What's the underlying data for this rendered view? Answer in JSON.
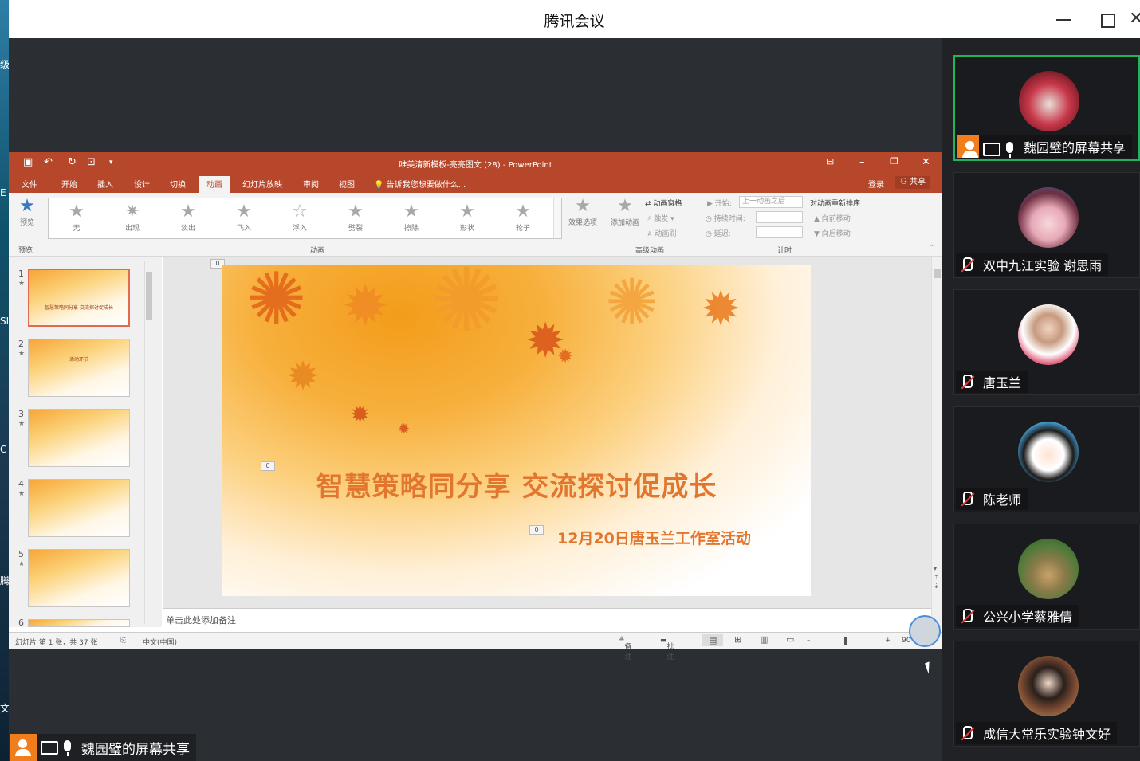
{
  "app": {
    "title": "腾讯会议"
  },
  "ppt": {
    "window_title": "唯美清新模板-亮亮图文 (28) - PowerPoint",
    "tabs": [
      "文件",
      "开始",
      "插入",
      "设计",
      "切换",
      "动画",
      "幻灯片放映",
      "审阅",
      "视图"
    ],
    "active_tab": "动画",
    "tell_me": "告诉我您想要做什么...",
    "login": "登录",
    "share": "共享",
    "preview_label": "预览",
    "preview_group": "预览",
    "animations": [
      "无",
      "出现",
      "淡出",
      "飞入",
      "浮入",
      "劈裂",
      "擦除",
      "形状",
      "轮子"
    ],
    "effect_options": "效果选项",
    "anim_group": "动画",
    "add_animation": "添加动画",
    "anim_pane": "动画窗格",
    "trigger": "触发",
    "anim_painter": "动画刷",
    "advanced_group": "高级动画",
    "start_label": "开始:",
    "start_value": "上一动画之后",
    "duration_label": "持续时间:",
    "delay_label": "延迟:",
    "reorder_title": "对动画重新排序",
    "move_earlier": "向前移动",
    "move_later": "向后移动",
    "timing_group": "计时",
    "slide_numbers": [
      "1",
      "2",
      "3",
      "4",
      "5",
      "6"
    ],
    "thumb_captions": [
      "智慧策略同分享 交流探讨促成长",
      "活动环节",
      "",
      "",
      "",
      ""
    ],
    "slide": {
      "title": "智慧策略同分享  交流探讨促成长",
      "subtitle": "12月20日唐玉兰工作室活动",
      "markers": [
        "0",
        "0",
        "0"
      ]
    },
    "notes_placeholder": "单击此处添加备注",
    "status": {
      "slide_info": "幻灯片 第 1 张，共 37 张",
      "language": "中文(中国)",
      "notes": "备注",
      "comments": "批注",
      "zoom": "90"
    }
  },
  "sharer_label": "魏园璧的屏幕共享",
  "participants": [
    {
      "name": "魏园璧的屏幕共享",
      "active": true
    },
    {
      "name": "双中九江实验 谢思雨"
    },
    {
      "name": "唐玉兰"
    },
    {
      "name": "陈老师"
    },
    {
      "name": "公兴小学蔡雅倩"
    },
    {
      "name": "成信大常乐实验钟文好"
    }
  ],
  "colors": {
    "ppt_accent": "#b7472a",
    "tile_active": "#22b35b",
    "orange": "#f07e1d",
    "mute_red": "#e53935"
  }
}
